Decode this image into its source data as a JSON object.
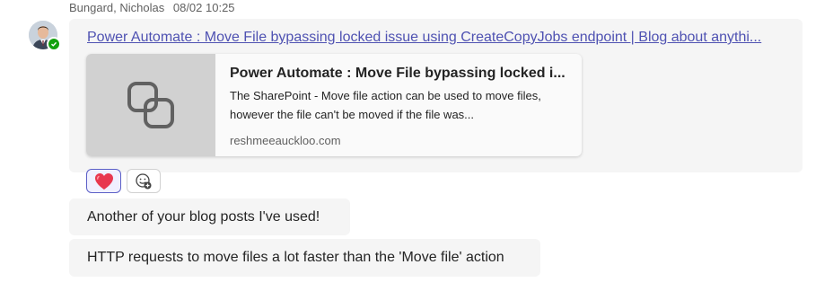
{
  "message_header": {
    "author": "Bungard, Nicholas",
    "timestamp": "08/02 10:25"
  },
  "avatar": {
    "presence": "available",
    "presence_color": "#13a10e"
  },
  "messages": [
    {
      "link_text": "Power Automate : Move File bypassing locked issue using CreateCopyJobs endpoint | Blog about anythi...",
      "preview": {
        "icon": "link-icon",
        "title": "Power Automate : Move File bypassing locked i...",
        "description": "The SharePoint - Move file action can be used to move files, however the file can't be moved if the file was...",
        "domain": "reshmeeauckloo.com"
      },
      "reactions": [
        {
          "icon": "heart-icon",
          "selected": true
        },
        {
          "icon": "add-reaction-icon"
        }
      ]
    },
    {
      "text": "Another of your blog posts I've used!"
    },
    {
      "text": "HTTP requests to move files a lot faster than the 'Move file' action"
    }
  ],
  "colors": {
    "link": "#4f52b2",
    "bubble": "#f5f5f5",
    "accent": "#5b5fc7",
    "heart": "#e8384f"
  }
}
